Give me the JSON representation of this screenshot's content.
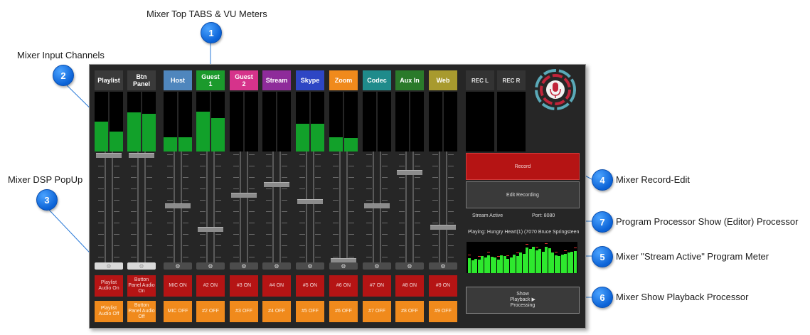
{
  "callouts": [
    {
      "num": "1",
      "label": "Mixer Top TABS & VU Meters"
    },
    {
      "num": "2",
      "label": "Mixer Input Channels"
    },
    {
      "num": "3",
      "label": "Mixer DSP PopUp"
    },
    {
      "num": "4",
      "label": "Mixer Record-Edit"
    },
    {
      "num": "7",
      "label": "Program Processor Show (Editor) Processor"
    },
    {
      "num": "5",
      "label": "Mixer \"Stream Active\" Program Meter"
    },
    {
      "num": "6",
      "label": "Mixer Show Playback Processor"
    }
  ],
  "channels": [
    {
      "label": "Playlist",
      "color": "#3a3a3a",
      "on": "Playlist\nAudio On",
      "off": "Playlist\nAudio Off",
      "meter_l": 0.5,
      "meter_r": 0.33,
      "fader": 1.0
    },
    {
      "label": "Btn\nPanel",
      "color": "#3a3a3a",
      "on": "Button\nPanel Audio\nOn",
      "off": "Button\nPanel Audio\nOff",
      "meter_l": 0.65,
      "meter_r": 0.63,
      "fader": 1.0
    },
    {
      "label": "Host",
      "color": "#4f86bd",
      "on": "MIC ON",
      "off": "MIC OFF",
      "meter_l": 0.24,
      "meter_r": 0.24,
      "fader": 0.52
    },
    {
      "label": "Guest\n1",
      "color": "#1b9a2c",
      "on": "#2 ON",
      "off": "#2 OFF",
      "meter_l": 0.67,
      "meter_r": 0.56,
      "fader": 0.3
    },
    {
      "label": "Guest\n2",
      "color": "#d6338b",
      "on": "#3 ON",
      "off": "#3 OFF",
      "meter_l": 0.0,
      "meter_r": 0.0,
      "fader": 0.62
    },
    {
      "label": "Stream",
      "color": "#8e2b9a",
      "on": "#4 ON",
      "off": "#4 OFF",
      "meter_l": 0.0,
      "meter_r": 0.0,
      "fader": 0.72
    },
    {
      "label": "Skype",
      "color": "#2e46c4",
      "on": "#5 ON",
      "off": "#5 OFF",
      "meter_l": 0.46,
      "meter_r": 0.46,
      "fader": 0.56
    },
    {
      "label": "Zoom",
      "color": "#f08a1c",
      "on": "#6 ON",
      "off": "#6 OFF",
      "meter_l": 0.24,
      "meter_r": 0.23,
      "fader": 0.0
    },
    {
      "label": "Codec",
      "color": "#1f8b8b",
      "on": "#7 ON",
      "off": "#7 OFF",
      "meter_l": 0.0,
      "meter_r": 0.0,
      "fader": 0.52
    },
    {
      "label": "Aux In",
      "color": "#2a7a2a",
      "on": "#8 ON",
      "off": "#8 OFF",
      "meter_l": 0.0,
      "meter_r": 0.0,
      "fader": 0.84
    },
    {
      "label": "Web",
      "color": "#a89a2e",
      "on": "#9 ON",
      "off": "#9 OFF",
      "meter_l": 0.0,
      "meter_r": 0.0,
      "fader": 0.32
    }
  ],
  "rec_tabs": [
    "REC L",
    "REC R"
  ],
  "record_label": "Record",
  "edit_label": "Edit Recording",
  "stream_status": "Stream Active",
  "port": "Port: 8080",
  "now_playing": "Playing: Hungry Heart(1) (7070 Bruce Springsteen",
  "show_label": "Show\nPlayback ▶\nProcessing",
  "program_meter_levels": [
    0.52,
    0.45,
    0.5,
    0.47,
    0.6,
    0.55,
    0.62,
    0.58,
    0.55,
    0.48,
    0.62,
    0.6,
    0.5,
    0.56,
    0.64,
    0.6,
    0.72,
    0.68,
    0.9,
    0.86,
    0.92,
    0.8,
    0.84,
    0.76,
    0.93,
    0.88,
    0.72,
    0.62,
    0.6,
    0.64,
    0.68,
    0.72,
    0.74,
    0.78
  ]
}
